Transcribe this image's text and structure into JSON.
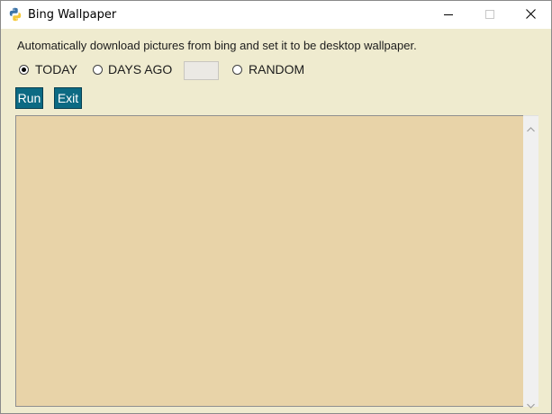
{
  "window": {
    "title": "Bing Wallpaper",
    "icon": "python-icon",
    "controls": {
      "minimize": "minimize-icon",
      "maximize": "maximize-icon",
      "close": "close-icon"
    }
  },
  "main": {
    "description": "Automatically download pictures from bing and set it to be desktop wallpaper.",
    "options": {
      "today_label": "TODAY",
      "days_ago_label": "DAYS AGO",
      "days_ago_value": "",
      "random_label": "RANDOM",
      "selected": "TODAY"
    },
    "buttons": {
      "run_label": "Run",
      "exit_label": "Exit"
    },
    "log": {
      "content": ""
    }
  },
  "colors": {
    "window_background": "#efebcf",
    "button_background": "#0c6a83",
    "log_background": "#e8d3a8"
  }
}
